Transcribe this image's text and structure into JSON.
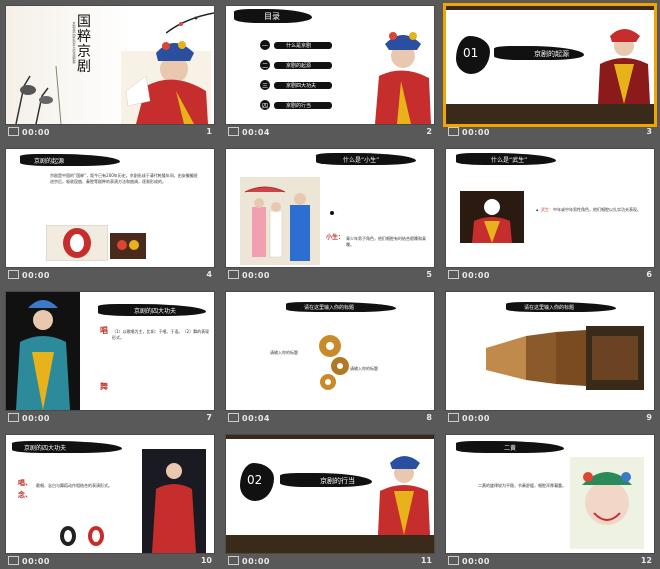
{
  "slides": [
    {
      "num": "1",
      "time": "00:00",
      "title_v": "国粹京剧",
      "subtitle": "京剧是中国影响最大的戏曲剧种"
    },
    {
      "num": "2",
      "time": "00:04",
      "title": "目录",
      "items": [
        "什么是京剧",
        "京剧的起源",
        "京剧四大功夫",
        "京剧的行当"
      ],
      "marks": [
        "一",
        "二",
        "三",
        "四"
      ]
    },
    {
      "num": "3",
      "time": "00:00",
      "big": "01",
      "title": "京剧的起源"
    },
    {
      "num": "4",
      "time": "00:00",
      "title": "京剧的起源",
      "body": "京剧是中国的“国粹”，距今已有200年历史。京剧形成于清代乾隆年间，由安徽徽班进京后，吸收昆曲、秦腔等剧种的表演方法和曲调，逐渐形成的。"
    },
    {
      "num": "5",
      "time": "00:00",
      "title": "什么是“小生”",
      "label": "小生：",
      "body": "青少年男子角色，他们唱腔有时结合假嗓和真嗓。"
    },
    {
      "num": "6",
      "time": "00:00",
      "title": "什么是“武生”",
      "label": "武生：",
      "body": "中年或中年男性角色，他们唱腔以扎实功夫表现。"
    },
    {
      "num": "7",
      "time": "00:00",
      "title": "京剧的四大功夫",
      "c1": "唱",
      "c2": "舞",
      "body": "（1）以歌唱为主，比如：于唱、于语。（2）舞的表现形式。"
    },
    {
      "num": "8",
      "time": "00:04",
      "title": "请在这里输入你的标题",
      "g1": "请输入你的标题",
      "g2": "请输入你的标题"
    },
    {
      "num": "9",
      "time": "00:00",
      "title": "请在这里输入你的标题"
    },
    {
      "num": "10",
      "time": "00:00",
      "title": "京剧的四大功夫",
      "c1": "唱、",
      "c2": "念、",
      "body": "歌唱、念白与舞蹈动作相结合的表演形式。"
    },
    {
      "num": "11",
      "time": "00:00",
      "big": "02",
      "title": "京剧的行当"
    },
    {
      "num": "12",
      "time": "00:00",
      "title": "二黄",
      "body": "二黄的旋律较为平稳，节奏舒缓，唱腔浑厚凝重。"
    }
  ]
}
